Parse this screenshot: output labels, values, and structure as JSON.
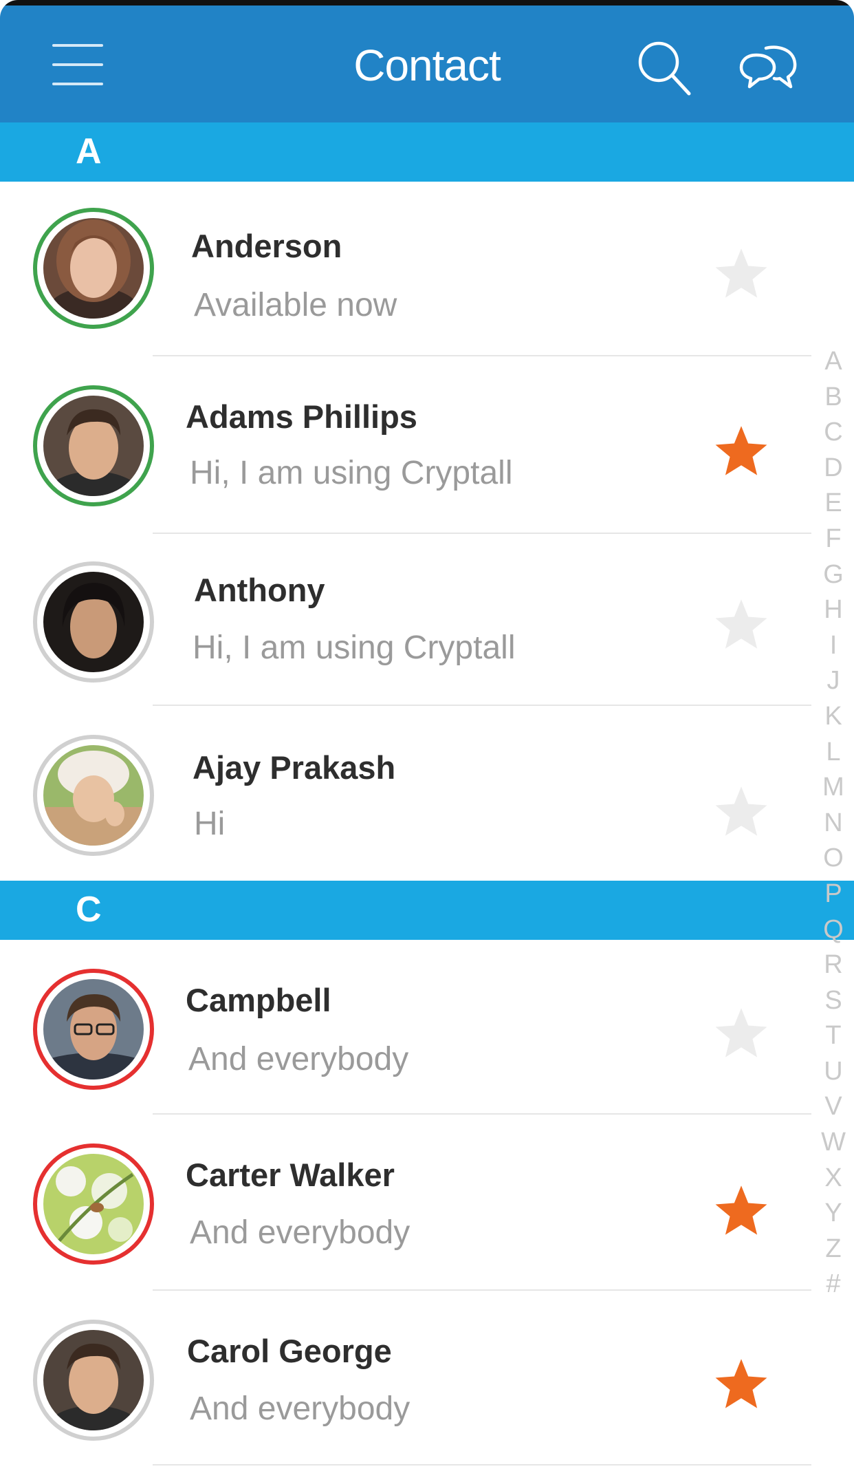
{
  "header": {
    "title": "Contact",
    "background": "#2183c6"
  },
  "sections": [
    {
      "letter": "A",
      "contacts": [
        {
          "name": "Anderson",
          "status": "Available now",
          "ring": "#3fa34d",
          "starred": false
        },
        {
          "name": "Adams Phillips",
          "status": "Hi, I am using Cryptall",
          "ring": "#3fa34d",
          "starred": true
        },
        {
          "name": "Anthony",
          "status": "Hi, I am using Cryptall",
          "ring": "#d0d0d0",
          "starred": false
        },
        {
          "name": "Ajay Prakash",
          "status": "Hi",
          "ring": "#d0d0d0",
          "starred": false
        }
      ]
    },
    {
      "letter": "C",
      "contacts": [
        {
          "name": "Campbell",
          "status": "And everybody",
          "ring": "#e53030",
          "starred": false
        },
        {
          "name": "Carter Walker",
          "status": "And everybody",
          "ring": "#e53030",
          "starred": true
        },
        {
          "name": "Carol George",
          "status": "And everybody",
          "ring": "#d0d0d0",
          "starred": true
        }
      ]
    }
  ],
  "index_letters": [
    "A",
    "B",
    "C",
    "D",
    "E",
    "F",
    "G",
    "H",
    "I",
    "J",
    "K",
    "L",
    "M",
    "N",
    "O",
    "P",
    "Q",
    "R",
    "S",
    "T",
    "U",
    "V",
    "W",
    "X",
    "Y",
    "Z",
    "#"
  ],
  "colors": {
    "section_bar": "#1aa8e2",
    "star_active": "#ee6a1f",
    "star_inactive": "#ececec",
    "online_ring": "#3fa34d",
    "busy_ring": "#e53030",
    "offline_ring": "#d0d0d0"
  },
  "icons": {
    "menu": "hamburger-menu-icon",
    "search": "search-icon",
    "chat": "chat-bubbles-icon",
    "star": "star-icon"
  }
}
